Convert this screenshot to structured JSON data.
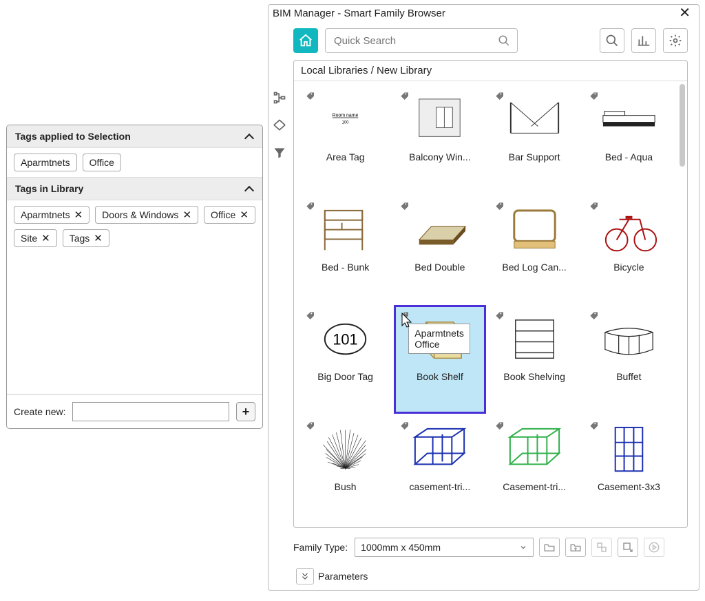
{
  "tags_panel": {
    "section_applied": "Tags applied to Selection",
    "applied_tags": [
      "Aparmtnets",
      "Office"
    ],
    "section_library": "Tags in Library",
    "library_tags": [
      "Aparmtnets",
      "Doors & Windows",
      "Office",
      "Site",
      "Tags"
    ],
    "create_label": "Create new:"
  },
  "browser": {
    "title": "BIM Manager - Smart Family Browser",
    "search_placeholder": "Quick Search",
    "breadcrumb": "Local Libraries / New Library",
    "tooltip": "Aparmtnets\nOffice",
    "selected_index": 9,
    "items": [
      {
        "label": "Area Tag"
      },
      {
        "label": "Balcony Win..."
      },
      {
        "label": "Bar Support"
      },
      {
        "label": "Bed - Aqua"
      },
      {
        "label": "Bed - Bunk"
      },
      {
        "label": "Bed Double"
      },
      {
        "label": "Bed Log Can..."
      },
      {
        "label": "Bicycle"
      },
      {
        "label": "Big Door Tag"
      },
      {
        "label": "Book Shelf"
      },
      {
        "label": "Book Shelving"
      },
      {
        "label": "Buffet"
      },
      {
        "label": "Bush"
      },
      {
        "label": "casement-tri..."
      },
      {
        "label": "Casement-tri..."
      },
      {
        "label": "Casement-3x3"
      }
    ],
    "big_tag_number": "101",
    "family_type_label": "Family Type:",
    "family_type_value": "1000mm x 450mm",
    "parameters_label": "Parameters"
  }
}
